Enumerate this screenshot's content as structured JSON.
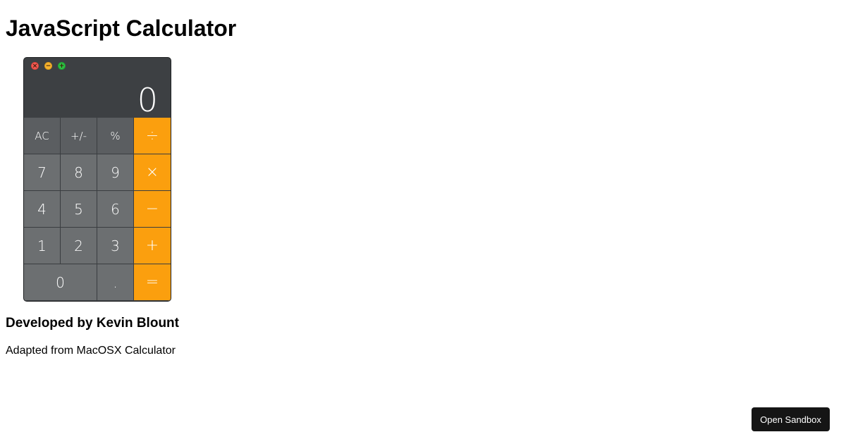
{
  "page": {
    "title": "JavaScript Calculator",
    "credit": "Developed by Kevin Blount",
    "subtitle": "Adapted from MacOSX Calculator"
  },
  "calculator": {
    "window_controls": {
      "close_glyph": "×",
      "minimize_glyph": "−",
      "maximize_glyph": "+"
    },
    "display": "0",
    "keys": {
      "ac": "AC",
      "sign": "+/-",
      "percent": "%",
      "divide": "÷",
      "seven": "7",
      "eight": "8",
      "nine": "9",
      "multiply": "×",
      "four": "4",
      "five": "5",
      "six": "6",
      "subtract": "−",
      "one": "1",
      "two": "2",
      "three": "3",
      "add": "+",
      "zero": "0",
      "decimal": ".",
      "equals": "="
    }
  },
  "sandbox_button": "Open Sandbox",
  "colors": {
    "operator": "#fb9f0e",
    "function_key": "#5b5e61",
    "number_key": "#6c6f71",
    "display_bg": "#3d4043",
    "button_bg": "#151515"
  }
}
